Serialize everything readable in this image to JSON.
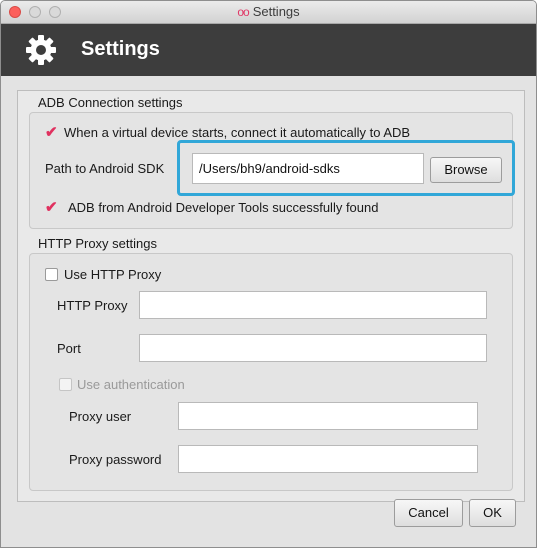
{
  "window": {
    "title": "Settings",
    "title_logo": "oo"
  },
  "header": {
    "title": "Settings",
    "icon": "gear-icon"
  },
  "adb": {
    "section_label": "ADB Connection settings",
    "auto_connect_label": "When a virtual device starts, connect it automatically to ADB",
    "auto_connect_checked": true,
    "sdk_path_label": "Path to Android SDK",
    "sdk_path_value": "/Users/bh9/android-sdks",
    "browse_label": "Browse",
    "status_text": "ADB from Android Developer Tools successfully found",
    "status_icon": "checkmark-icon"
  },
  "proxy": {
    "section_label": "HTTP Proxy settings",
    "use_proxy_label": "Use HTTP Proxy",
    "use_proxy_checked": false,
    "http_proxy_label": "HTTP Proxy",
    "http_proxy_value": "",
    "port_label": "Port",
    "port_value": "",
    "use_auth_label": "Use authentication",
    "use_auth_checked": false,
    "proxy_user_label": "Proxy user",
    "proxy_user_value": "",
    "proxy_password_label": "Proxy password",
    "proxy_password_value": ""
  },
  "footer": {
    "cancel_label": "Cancel",
    "ok_label": "OK"
  },
  "colors": {
    "accent_check": "#e0315f",
    "highlight": "#31a7d8",
    "header_bg": "#3d3d3d"
  }
}
